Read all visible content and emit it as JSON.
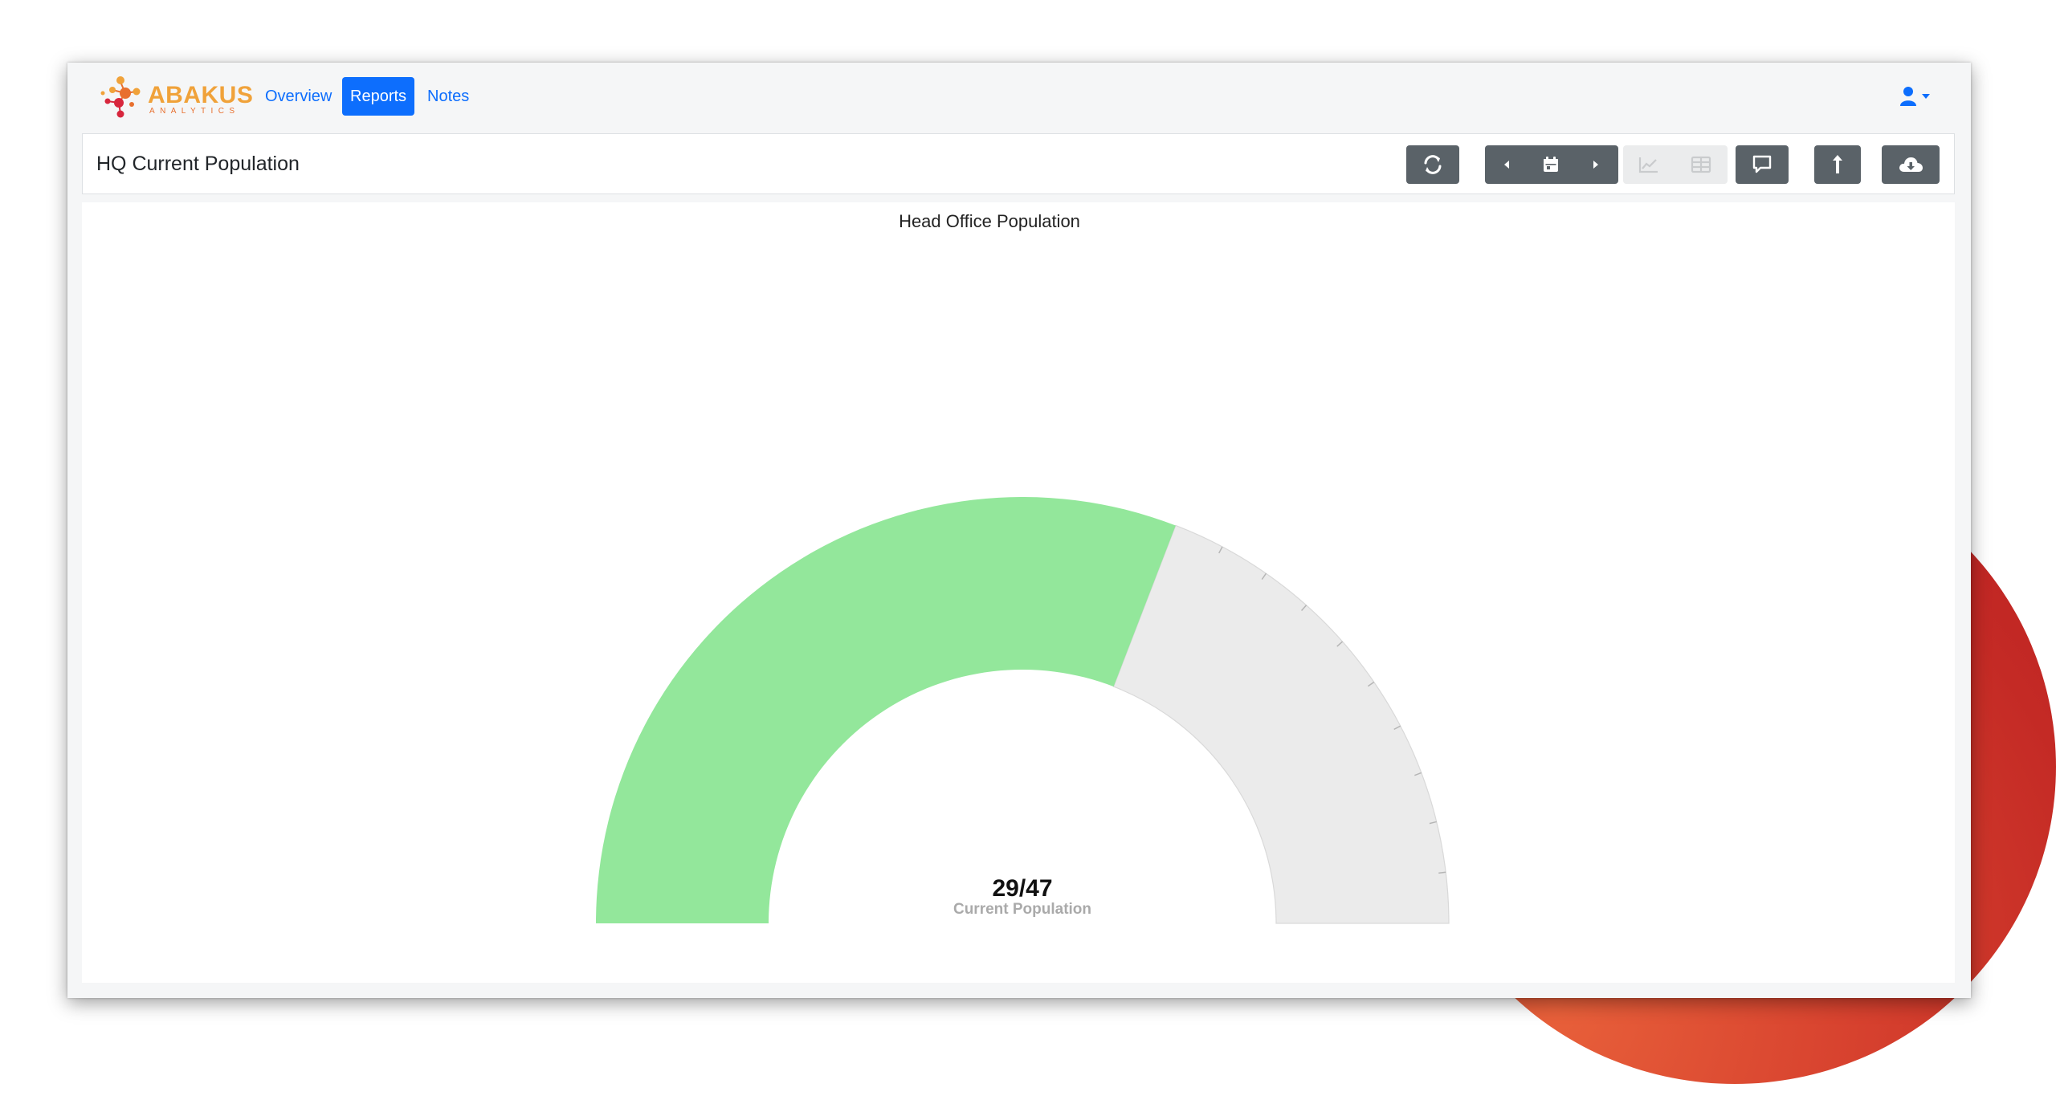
{
  "brand": {
    "name": "ABAKUS",
    "subtitle": "ANALYTICS"
  },
  "nav": {
    "items": [
      {
        "label": "Overview",
        "active": false
      },
      {
        "label": "Reports",
        "active": true
      },
      {
        "label": "Notes",
        "active": false
      }
    ]
  },
  "user_menu": {
    "icon": "user-icon",
    "caret": "caret-down-icon"
  },
  "report": {
    "title": "HQ Current Population",
    "toolbar": [
      {
        "icon": "refresh-icon",
        "enabled": true
      },
      {
        "icon": "chevron-left-icon",
        "enabled": true
      },
      {
        "icon": "calendar-icon",
        "enabled": true
      },
      {
        "icon": "chevron-right-icon",
        "enabled": true
      },
      {
        "icon": "line-chart-icon",
        "enabled": false
      },
      {
        "icon": "table-icon",
        "enabled": false
      },
      {
        "icon": "comment-icon",
        "enabled": true
      },
      {
        "icon": "share-icon",
        "enabled": true
      },
      {
        "icon": "cloud-download-icon",
        "enabled": true
      }
    ]
  },
  "chart_data": {
    "type": "gauge",
    "title": "Head Office Population",
    "value": 29,
    "max": 47,
    "min": 0,
    "value_label": "29/47",
    "caption": "Current Population",
    "colors": {
      "filled": "#93e79b",
      "empty": "#ebebeb"
    }
  },
  "colors": {
    "accent": "#0d6efd",
    "toolbar_button": "#5a6268",
    "toolbar_button_disabled": "#ebeced",
    "brand_orange": "#f0a23a",
    "brand_red": "#d7263d"
  }
}
